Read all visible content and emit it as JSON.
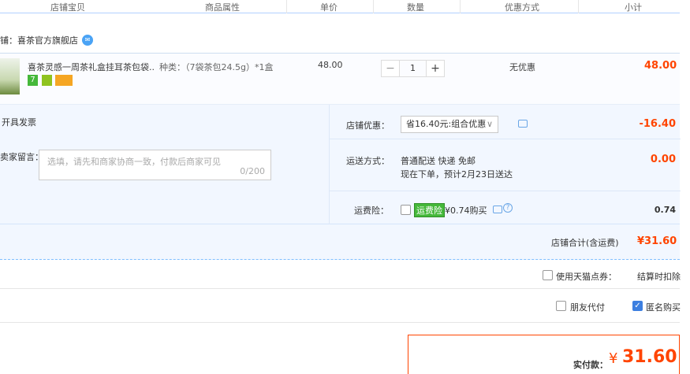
{
  "columns": [
    "店铺宝贝",
    "商品属性",
    "单价",
    "数量",
    "优惠方式",
    "小计"
  ],
  "shop": {
    "label": "铺：喜茶官方旗舰店"
  },
  "item": {
    "name": "喜茶灵感一周茶礼盒挂耳茶包袋...",
    "props": "种类：（7袋茶包24.5g）*1盒",
    "tags": [
      "7",
      "",
      ""
    ],
    "price": "48.00",
    "qty": "1",
    "qty_minus": "−",
    "qty_plus": "+",
    "discount": "无优惠",
    "subtotal": "48.00"
  },
  "invoice": {
    "label": "开具发票"
  },
  "message": {
    "label": "卖家留言：",
    "placeholder": "选填，请先和商家协商一致，付款后商家可见",
    "count": "0/200"
  },
  "shop_discount": {
    "label": "店铺优惠：",
    "selected": "省16.40元:组合优惠",
    "amount": "-16.40"
  },
  "shipping": {
    "label": "运送方式：",
    "method": "普通配送 快递 免邮",
    "eta": "现在下单，预计2月23日送达",
    "amount": "0.00"
  },
  "insurance": {
    "label": "运费险：",
    "badge": "运费险",
    "text": "¥0.74购买",
    "amount": "0.74"
  },
  "shop_total": {
    "label": "店铺合计(含运费)",
    "amount": "¥31.60"
  },
  "tmall_points": {
    "label": "使用天猫点券：",
    "note": "结算时扣除"
  },
  "friend_pay": {
    "label": "朋友代付"
  },
  "anonymous": {
    "label": "匿名购买"
  },
  "pay": {
    "label": "实付款：",
    "currency": "¥",
    "amount": "31.60"
  },
  "colors": {
    "accent": "#ff4400",
    "border_blue": "#b2d1ff",
    "panel_bg": "#f2f7ff"
  }
}
